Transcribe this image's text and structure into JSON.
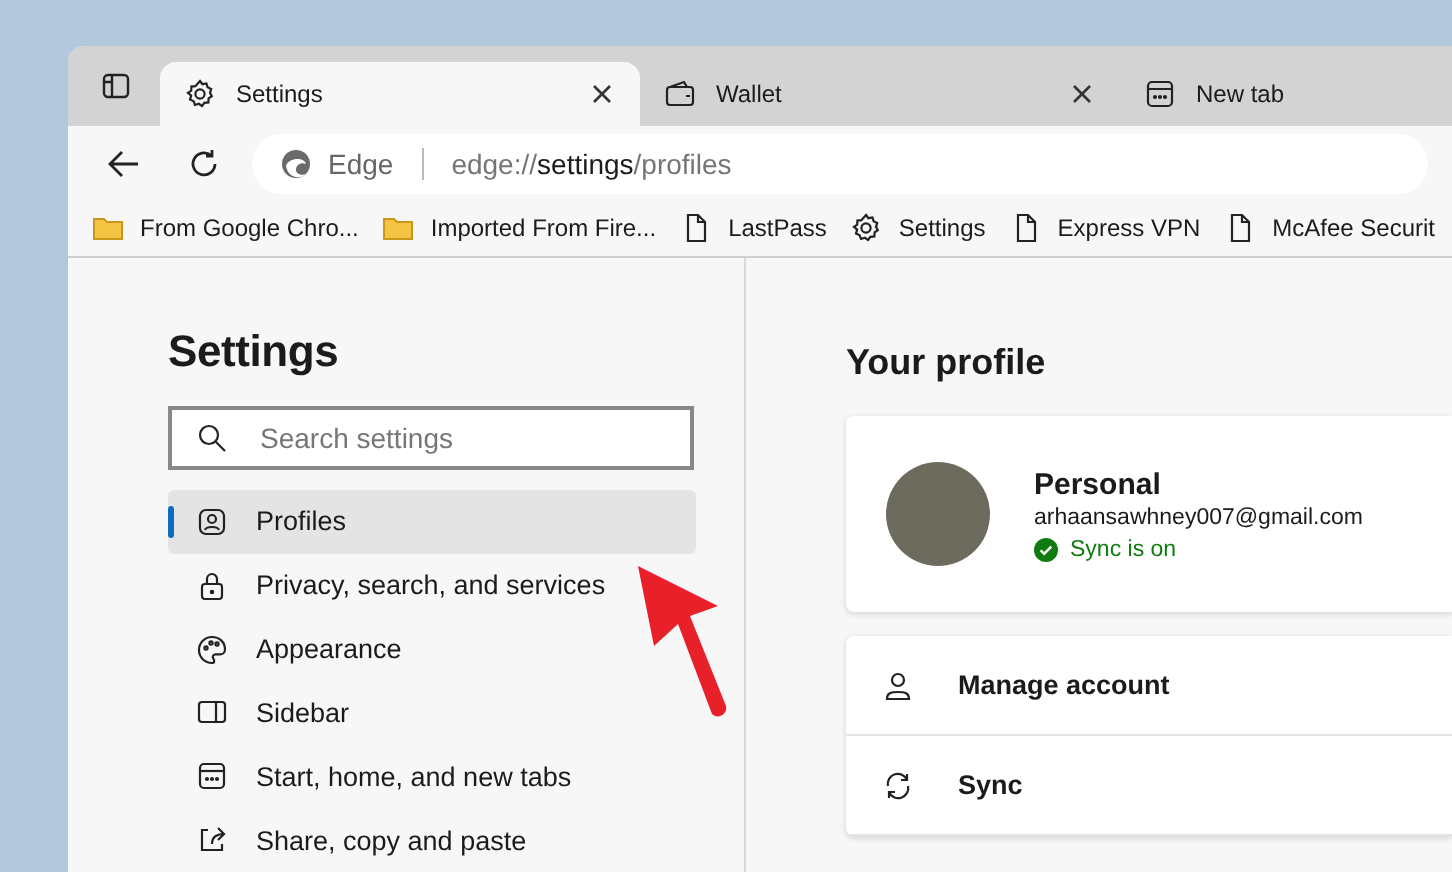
{
  "tabs": [
    {
      "label": "Settings",
      "kind": "gear",
      "selected": true,
      "closable": true
    },
    {
      "label": "Wallet",
      "kind": "wallet",
      "selected": false,
      "closable": true
    },
    {
      "label": "New tab",
      "kind": "newtab",
      "selected": false,
      "closable": false
    }
  ],
  "address_bar": {
    "site_label": "Edge",
    "url_prefix": "edge://",
    "url_host": "settings",
    "url_path": "/profiles"
  },
  "bookmarks": [
    {
      "label": "From Google Chro...",
      "kind": "folder"
    },
    {
      "label": "Imported From Fire...",
      "kind": "folder"
    },
    {
      "label": "LastPass",
      "kind": "page"
    },
    {
      "label": "Settings",
      "kind": "gear"
    },
    {
      "label": "Express VPN",
      "kind": "page"
    },
    {
      "label": "McAfee Securit",
      "kind": "page"
    }
  ],
  "sidebar": {
    "title": "Settings",
    "search": {
      "placeholder": "Search settings"
    },
    "items": [
      {
        "label": "Profiles",
        "kind": "profile",
        "selected": true
      },
      {
        "label": "Privacy, search, and services",
        "kind": "lock",
        "selected": false
      },
      {
        "label": "Appearance",
        "kind": "palette",
        "selected": false
      },
      {
        "label": "Sidebar",
        "kind": "sidebar",
        "selected": false
      },
      {
        "label": "Start, home, and new tabs",
        "kind": "newtab",
        "selected": false
      },
      {
        "label": "Share, copy and paste",
        "kind": "share",
        "selected": false
      }
    ]
  },
  "main": {
    "title": "Your profile",
    "profile": {
      "name": "Personal",
      "email": "arhaansawhney007@gmail.com",
      "sync_status": "Sync is on",
      "synced": true
    },
    "options": [
      {
        "label": "Manage account",
        "kind": "person"
      },
      {
        "label": "Sync",
        "kind": "sync"
      }
    ]
  }
}
